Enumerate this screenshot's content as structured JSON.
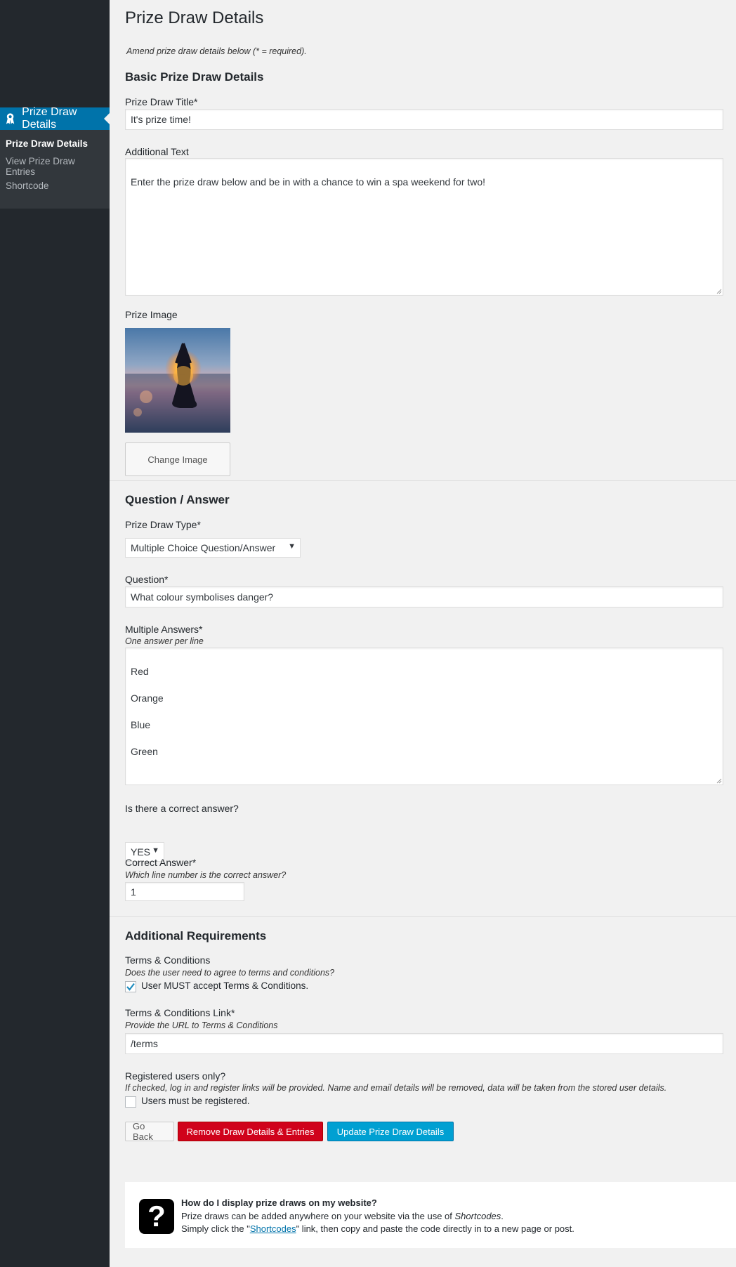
{
  "sidebar": {
    "active_menu": "Prize Draw Details",
    "items": [
      {
        "label": "Prize Draw Details"
      },
      {
        "label": "View Prize Draw Entries"
      },
      {
        "label": "Shortcode"
      }
    ]
  },
  "page": {
    "title": "Prize Draw Details",
    "intro": "Amend prize draw details below (* = required)."
  },
  "basic": {
    "heading": "Basic Prize Draw Details",
    "title_label": "Prize Draw Title*",
    "title_value": "It's prize time!",
    "additional_label": "Additional Text",
    "additional_value": "Enter the prize draw below and be in with a chance to win a spa weekend for two!",
    "image_label": "Prize Image",
    "change_image": "Change Image"
  },
  "qa": {
    "heading": "Question / Answer",
    "type_label": "Prize Draw Type*",
    "type_value": "Multiple Choice Question/Answer",
    "question_label": "Question*",
    "question_value": "What colour symbolises danger?",
    "answers_label": "Multiple Answers*",
    "answers_desc": "One answer per line",
    "answers": [
      "Red",
      "Orange",
      "Blue",
      "Green"
    ],
    "correct_q_label": "Is there a correct answer?",
    "correct_q_value": "YES",
    "correct_label": "Correct Answer*",
    "correct_desc": "Which line number is the correct answer?",
    "correct_value": "1"
  },
  "req": {
    "heading": "Additional Requirements",
    "tc_label": "Terms & Conditions",
    "tc_desc": "Does the user need to agree to terms and conditions?",
    "tc_check": "User MUST accept Terms & Conditions.",
    "tc_checked": true,
    "tc_link_label": "Terms & Conditions Link*",
    "tc_link_desc": "Provide the URL to Terms & Conditions",
    "tc_link_value": "/terms",
    "reg_label": "Registered users only?",
    "reg_desc": "If checked, log in and register links will be provided. Name and email details will be removed, data will be taken from the stored user details.",
    "reg_check": "Users must be registered.",
    "reg_checked": false
  },
  "buttons": {
    "back": "Go Back",
    "remove": "Remove Draw Details & Entries",
    "update": "Update Prize Draw Details"
  },
  "help": {
    "title": "How do I display prize draws on my website?",
    "line1_pre": "Prize draws can be added anywhere on your website via the use of ",
    "line1_em": "Shortcodes",
    "line1_post": ".",
    "line2_pre": "Simply click the \"",
    "line2_link": "Shortcodes",
    "line2_post": "\" link, then copy and paste the code directly in to a new page or post."
  },
  "colors": {
    "sidebar_bg": "#23282d",
    "sidebar_active": "#0073aa",
    "danger": "#d0021b",
    "primary": "#00a0d2"
  }
}
